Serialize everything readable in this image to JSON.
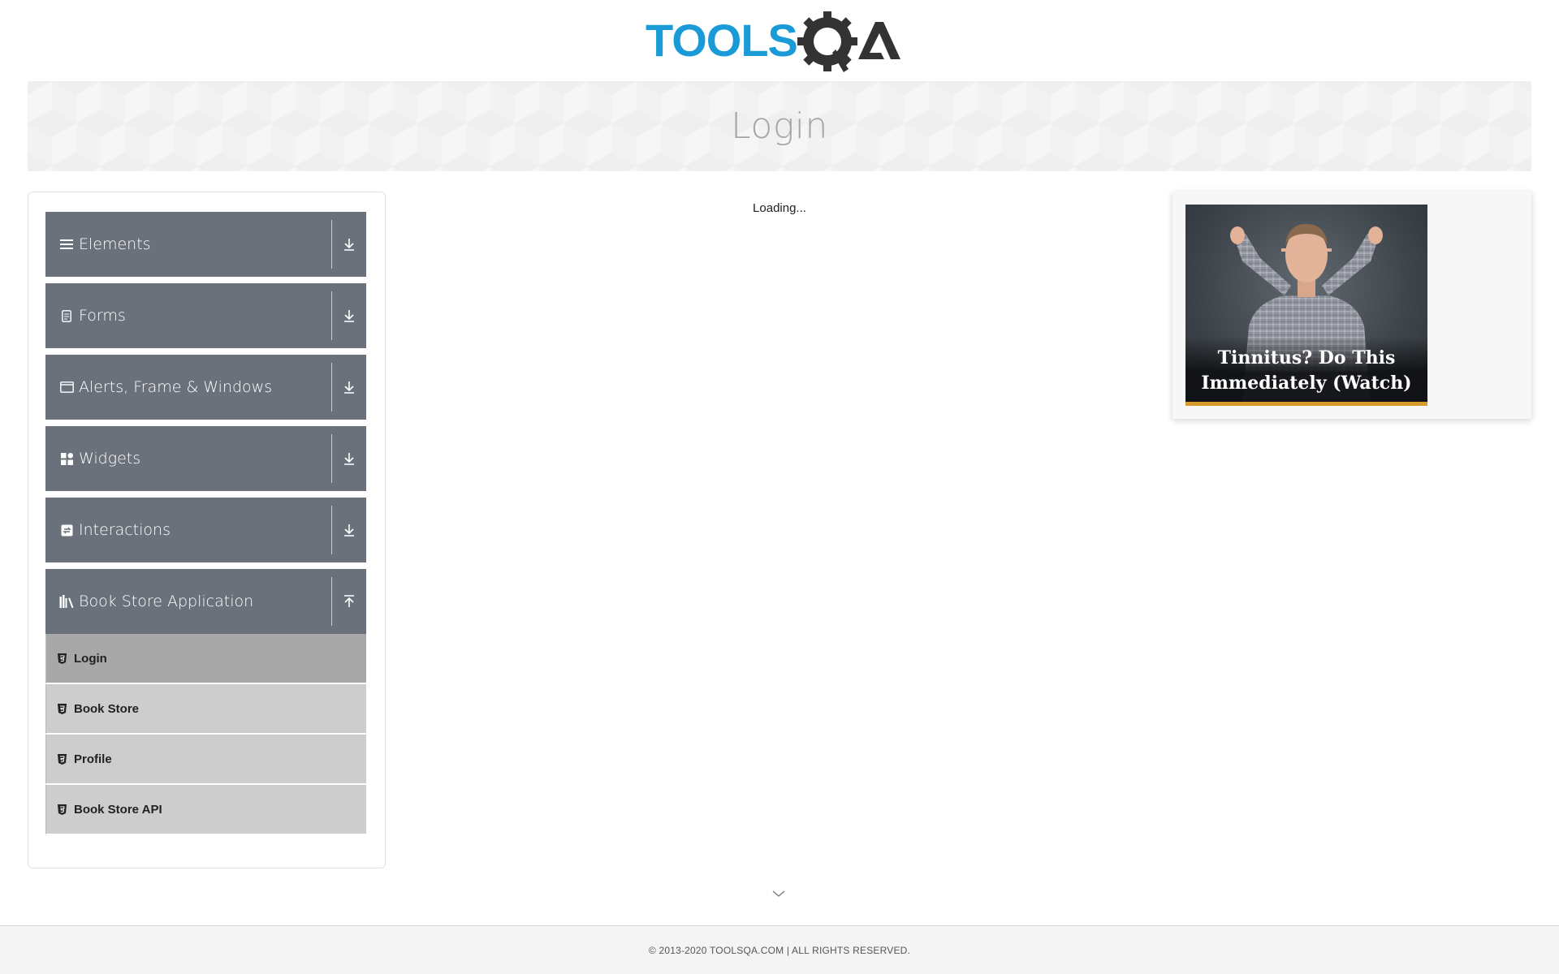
{
  "header": {
    "logo_text": "TOOLSQA"
  },
  "page": {
    "title": "Login",
    "status": "Loading..."
  },
  "sidebar": {
    "groups": [
      {
        "label": "Elements",
        "icon": "menu-icon",
        "state": "collapsed"
      },
      {
        "label": "Forms",
        "icon": "form-icon",
        "state": "collapsed"
      },
      {
        "label": "Alerts, Frame & Windows",
        "icon": "window-icon",
        "state": "collapsed"
      },
      {
        "label": "Widgets",
        "icon": "widgets-icon",
        "state": "collapsed"
      },
      {
        "label": "Interactions",
        "icon": "interactions-icon",
        "state": "collapsed"
      },
      {
        "label": "Book Store Application",
        "icon": "bookshelf-icon",
        "state": "expanded"
      }
    ],
    "submenu": [
      {
        "label": "Login",
        "active": true
      },
      {
        "label": "Book Store",
        "active": false
      },
      {
        "label": "Profile",
        "active": false
      },
      {
        "label": "Book Store API",
        "active": false
      }
    ]
  },
  "ad": {
    "line1": "Tinnitus? Do This",
    "line2": "Immediately (Watch)"
  },
  "footer": {
    "copyright": "© 2013-2020 TOOLSQA.COM | ALL RIGHTS RESERVED."
  },
  "colors": {
    "brand_blue": "#1a9bd7",
    "brand_dark": "#333333",
    "menu_bg": "#6b717b",
    "sub_bg": "#cdcdcd",
    "sub_active_bg": "#a8a8a8"
  }
}
